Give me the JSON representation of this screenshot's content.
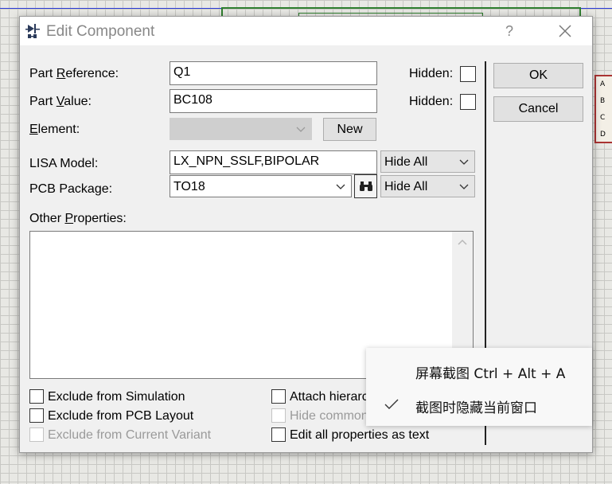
{
  "dialog": {
    "title": "Edit Component",
    "help_label": "?"
  },
  "form": {
    "part_reference": {
      "label_pre": "Part ",
      "label_accel": "R",
      "label_post": "eference:",
      "value": "Q1",
      "hidden_label": "Hidden:"
    },
    "part_value": {
      "label_pre": "Part ",
      "label_accel": "V",
      "label_post": "alue:",
      "value": "BC108",
      "hidden_label": "Hidden:"
    },
    "element": {
      "label_accel": "E",
      "label_post": "lement:",
      "value": "",
      "new_button": "New"
    },
    "lisa_model": {
      "label": "LISA Model:",
      "value": "LX_NPN_SSLF,BIPOLAR",
      "visibility": "Hide All"
    },
    "pcb_package": {
      "label": "PCB Package:",
      "value": "TO18",
      "visibility": "Hide All"
    },
    "other_properties": {
      "label_pre": "Other ",
      "label_accel": "P",
      "label_post": "roperties:",
      "value": ""
    }
  },
  "buttons": {
    "ok": "OK",
    "cancel": "Cancel"
  },
  "options": {
    "exclude_simulation": "Exclude from Simulation",
    "exclude_pcb": "Exclude from PCB Layout",
    "exclude_variant": "Exclude from Current Variant",
    "attach_hierarchy": "Attach hierarchy module",
    "hide_common_pins": "Hide common pins",
    "edit_as_text": "Edit all properties as text"
  },
  "context_menu": {
    "items": [
      "屏幕截图 Ctrl + Alt + A",
      "截图时隐藏当前窗口"
    ],
    "checked_item": "截图时隐藏当前窗口"
  },
  "background_chip": {
    "pins": [
      "A",
      "B",
      "C",
      "D"
    ]
  },
  "colors": {
    "grid_bg": "#e8e8e4",
    "schematic_green": "#2f7f2f",
    "chip_red": "#aa3333",
    "wire_blue": "#2b3bd9"
  }
}
